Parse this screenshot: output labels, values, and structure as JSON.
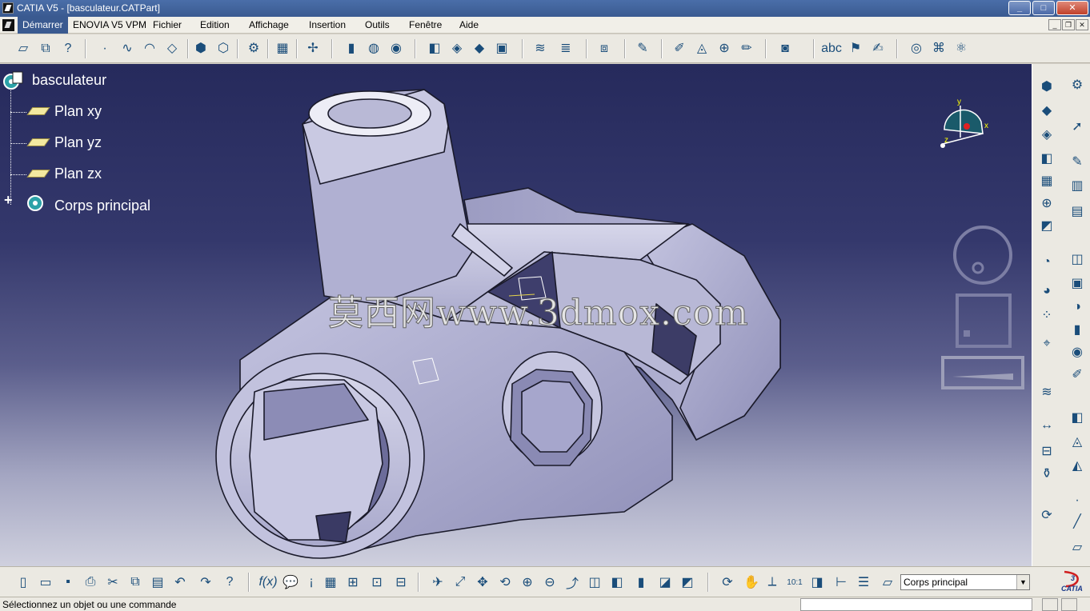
{
  "window": {
    "title": "CATIA V5 - [basculateur.CATPart]",
    "minimize": "_",
    "maximize": "□",
    "close": "✕"
  },
  "menu": {
    "items": [
      "Démarrer",
      "ENOVIA V5 VPM",
      "Fichier",
      "Edition",
      "Affichage",
      "Insertion",
      "Outils",
      "Fenêtre",
      "Aide"
    ]
  },
  "tree": {
    "root": "basculateur",
    "children": [
      "Plan xy",
      "Plan yz",
      "Plan zx",
      "Corps principal"
    ]
  },
  "watermark": "莫西网www.3dmox.com",
  "compass": {
    "x": "x",
    "y": "y",
    "z": "z"
  },
  "bottom_toolbar": {
    "current_body": "Corps principal"
  },
  "catia_logo": "CATIA",
  "status": {
    "message": "Sélectionnez un objet ou une commande"
  }
}
